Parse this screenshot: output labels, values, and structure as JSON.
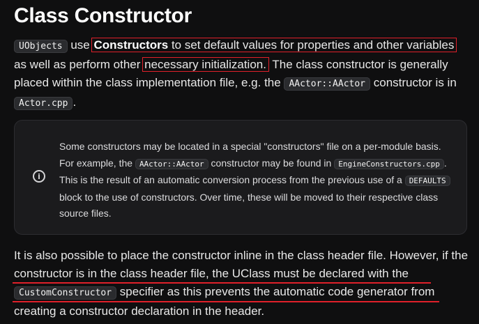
{
  "title": "Class Constructor",
  "para1": {
    "code_uobjects": "UObjects",
    "t1": " use ",
    "strong_constructors": "Constructors",
    "t2": " to set default values for properties and other variables as well as perform other ",
    "highlight": "necessary initialization.",
    "t3": " The class constructor is generally placed within the class implementation file, e.g. the ",
    "code_aactor": "AActor::AActor",
    "t4": " constructor is in ",
    "code_actorcpp": "Actor.cpp",
    "t5": "."
  },
  "note": {
    "icon": "info-circle-icon",
    "t1": "Some constructors may be located in a special \"constructors\" file on a per-module basis. For example, the ",
    "code_aactor": "AActor::AActor",
    "t2": " constructor may be found in ",
    "code_engine": "EngineConstructors.cpp",
    "t3": ". This is the result of an automatic conversion process from the previous use of a ",
    "code_defaults": "DEFAULTS",
    "t4": " block to the use of constructors. Over time, these will be moved to their respective class source files."
  },
  "para2": {
    "t1": "It is also possible to place the constructor inline in the class header file. However, if the constructor is in the class header file, the UClass must be declared with the ",
    "code_custom": "CustomConstructor",
    "t2": " specifier as this prevents the automatic code generator from creating a constructor declaration in the header."
  },
  "colors": {
    "annotation_red": "#e0202a",
    "background": "#0f0f10",
    "note_background": "#1b1b1d"
  }
}
